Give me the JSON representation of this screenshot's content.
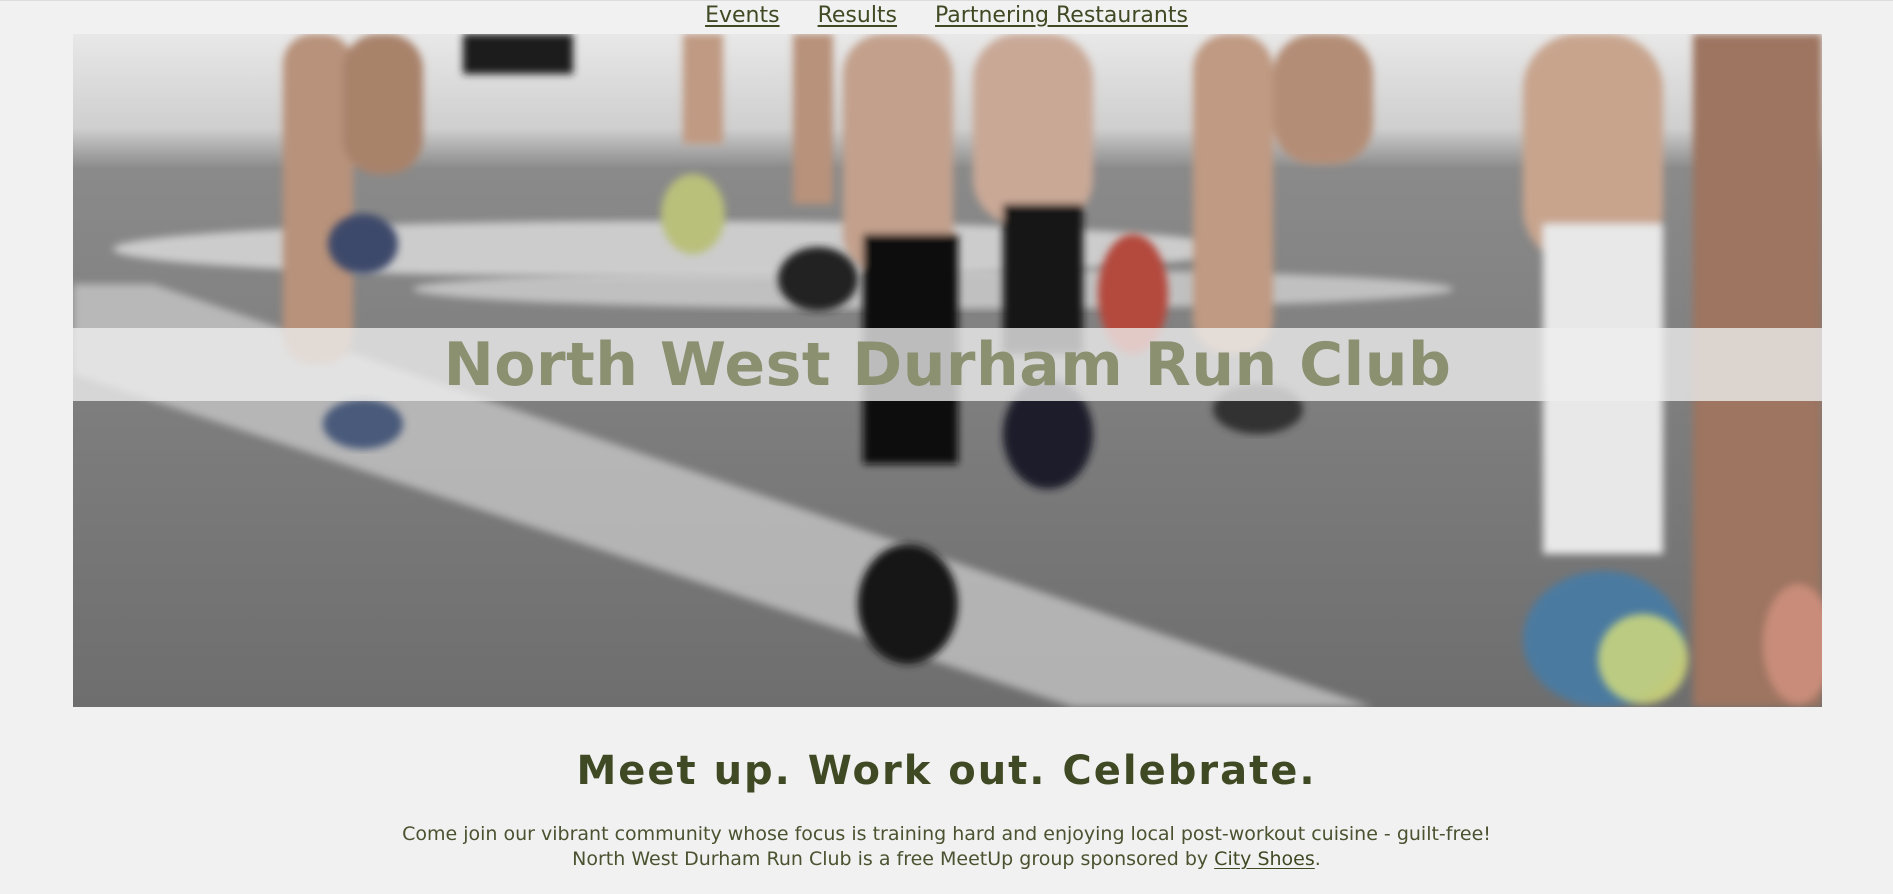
{
  "nav": {
    "items": [
      {
        "label": "Events"
      },
      {
        "label": "Results"
      },
      {
        "label": "Partnering Restaurants"
      }
    ]
  },
  "hero": {
    "title": "North West Durham Run Club"
  },
  "tagline": "Meet up. Work out. Celebrate.",
  "intro": {
    "line1": "Come join our vibrant community whose focus is training hard and enjoying local post-workout cuisine - guilt-free!",
    "line2_prefix": "North West Durham Run Club is a free MeetUp group sponsored by ",
    "sponsor_link": "City Shoes",
    "line2_suffix": "."
  },
  "colors": {
    "page_bg": "#f1f1f1",
    "accent_text": "#3f4a24",
    "hero_title": "#8a9070"
  }
}
